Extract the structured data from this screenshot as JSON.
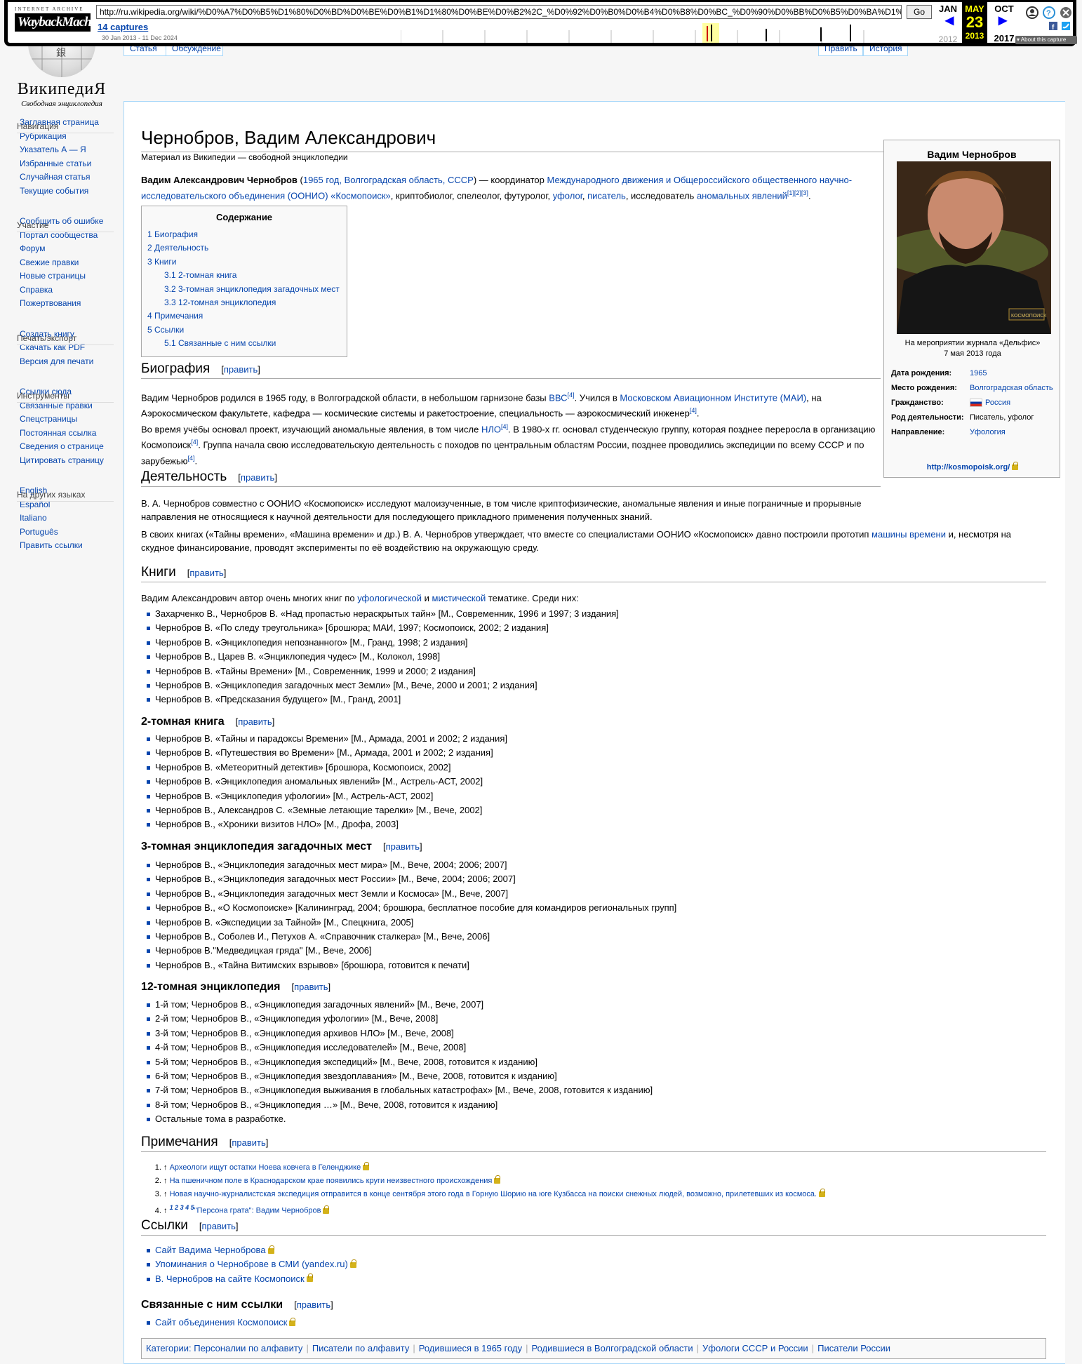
{
  "wayback": {
    "brand_top": "INTERNET ARCHIVE",
    "brand": "WaybackMachine",
    "url": "http://ru.wikipedia.org/wiki/%D0%A7%D0%B5%D1%80%D0%BD%D0%BE%D0%B1%D1%80%D0%BE%D0%B2%2C_%D0%92%D0%B0%D0%B4%D0%B8%D0%BC_%D0%90%D0%BB%D0%B5%D0%BA%D1%",
    "go": "Go",
    "captures": "14 captures",
    "range": "30 Jan 2013 - 11 Dec 2024",
    "prev_month": "JAN",
    "cur_month": "MAY",
    "next_month": "OCT",
    "day": "23",
    "prev_year": "2012",
    "cur_year": "2013",
    "next_year": "2017",
    "about": "About this capture"
  },
  "tabs": {
    "article": "Статья",
    "discussion": "Обсуждение",
    "edit": "Править",
    "history": "История"
  },
  "logo": {
    "name": "ВикипедиЯ",
    "sub": "Свободная энциклопедия"
  },
  "sidebar": [
    {
      "title": "Навигация",
      "items": [
        "Заглавная страница",
        "Рубрикация",
        "Указатель А — Я",
        "Избранные статьи",
        "Случайная статья",
        "Текущие события"
      ]
    },
    {
      "title": "Участие",
      "items": [
        "Сообщить об ошибке",
        "Портал сообщества",
        "Форум",
        "Свежие правки",
        "Новые страницы",
        "Справка",
        "Пожертвования"
      ]
    },
    {
      "title": "Печать/экспорт",
      "items": [
        "Создать книгу",
        "Скачать как PDF",
        "Версия для печати"
      ]
    },
    {
      "title": "Инструменты",
      "items": [
        "Ссылки сюда",
        "Связанные правки",
        "Спецстраницы",
        "Постоянная ссылка",
        "Сведения о странице",
        "Цитировать страницу"
      ]
    },
    {
      "title": "На других языках",
      "items": [
        "English",
        "Español",
        "Italiano",
        "Português",
        "Править ссылки"
      ]
    }
  ],
  "article": {
    "title": "Чернобров, Вадим Александрович",
    "sitesub": "Материал из Википедии — свободной энциклопедии",
    "edit": "править",
    "lead": {
      "bold": "Вадим Александрович Чернобров",
      "p1": " (",
      "l1": "1965 год",
      "p2": ", ",
      "l2": "Волгоградская область",
      "p3": ", ",
      "l3": "СССР",
      "p4": ") — координатор ",
      "l4": "Международного движения и Общероссийского общественного научно-исследовательского объединения (ООНИО) «Космопоиск»",
      "p5": ", криптобиолог, спелеолог, футуролог, ",
      "l5": "уфолог",
      "p6": ", ",
      "l6": "писатель",
      "p7": ", исследователь ",
      "l7": "аномальных явлений",
      "refs": "[1][2][3]",
      "p8": "."
    },
    "toc": {
      "title": "Содержание",
      "items": [
        {
          "t": "1 Биография",
          "l": 1
        },
        {
          "t": "2 Деятельность",
          "l": 1
        },
        {
          "t": "3 Книги",
          "l": 1
        },
        {
          "t": "3.1 2-томная книга",
          "l": 2
        },
        {
          "t": "3.2 3-томная энциклопедия загадочных мест",
          "l": 2
        },
        {
          "t": "3.3 12-томная энциклопедия",
          "l": 2
        },
        {
          "t": "4 Примечания",
          "l": 1
        },
        {
          "t": "5 Ссылки",
          "l": 1
        },
        {
          "t": "5.1 Связанные с ним ссылки",
          "l": 2
        }
      ]
    },
    "h_bio": "Биография",
    "bio1": {
      "a": "Вадим Чернобров родился в 1965 году, в Волгоградской области, в небольшом гарнизоне базы ",
      "l1": "ВВС",
      "r1": "[4]",
      "b": ". Учился в ",
      "l2": "Московском Авиационном Институте (МАИ)",
      "c": ", на Аэрокосмическом факультете, кафедра — космические системы и ракетостроение, специальность — аэрокосмический инженер",
      "r2": "[4]",
      "d": "."
    },
    "bio2": {
      "a": "Во время учёбы основал проект, изучающий аномальные явления, в том числе ",
      "l1": "НЛО",
      "r1": "[4]",
      "b": ". В 1980-х гг. основал студенческую группу, которая позднее переросла в организацию Космопоиск",
      "r2": "[4]",
      "c": ". Группа начала свою исследовательскую деятельность с походов по центральным областям России, позднее проводились экспедиции по всему СССР и по зарубежью",
      "r3": "[4]",
      "d": "."
    },
    "h_act": "Деятельность",
    "act1": "В. А. Чернобров совместно с ООНИО «Космопоиск» исследуют малоизученные, в том числе криптофизические, аномальные явления и иные пограничные и прорывные направления не относящиеся к научной деятельности для последующего прикладного применения полученных знаний.",
    "act2": {
      "a": "В своих книгах («Тайны времени», «Машина времени» и др.) В. А. Чернобров утверждает, что вместе со специалистами ООНИО «Космопоиск» давно построили прототип ",
      "l1": "машины времени",
      "b": " и, несмотря на скудное финансирование, проводят эксперименты по её воздействию на окружающую среду."
    },
    "h_books": "Книги",
    "books_intro": {
      "a": "Вадим Александрович автор очень многих книг по ",
      "l1": "уфологической",
      "b": " и ",
      "l2": "мистической",
      "c": " тематике. Среди них:"
    },
    "books": [
      "Захарченко В., Чернобров В. «Над пропастью нераскрытых тайн» [М., Современник, 1996 и 1997; 3 издания]",
      "Чернобров В. «По следу треугольника» [брошюра; МАИ, 1997; Космопоиск, 2002; 2 издания]",
      "Чернобров В. «Энциклопедия непознанного» [М., Гранд, 1998; 2 издания]",
      "Чернобров В., Царев В. «Энциклопедия чудес» [М., Колокол, 1998]",
      "Чернобров В. «Тайны Времени» [М., Современник, 1999 и 2000; 2 издания]",
      "Чернобров В. «Энциклопедия загадочных мест Земли» [М., Вече, 2000 и 2001; 2 издания]",
      "Чернобров В. «Предсказания будущего» [М., Гранд, 2001]"
    ],
    "h_2vol": "2-томная книга",
    "books2": [
      "Чернобров В. «Тайны и парадоксы Времени» [М., Армада, 2001 и 2002; 2 издания]",
      "Чернобров В. «Путешествия во Времени» [М., Армада, 2001 и 2002; 2 издания]",
      "Чернобров В. «Метеоритный детектив» [брошюра, Космопоиск, 2002]",
      "Чернобров В. «Энциклопедия аномальных явлений» [М., Астрель-АСТ, 2002]",
      "Чернобров В. «Энциклопедия уфологии» [М., Астрель-АСТ, 2002]",
      "Чернобров В., Александров С. «Земные летающие тарелки» [М., Вече, 2002]",
      "Чернобров В., «Хроники визитов НЛО» [М., Дрофа, 2003]"
    ],
    "h_3vol": "3-томная энциклопедия загадочных мест",
    "books3": [
      "Чернобров В., «Энциклопедия загадочных мест мира» [М., Вече, 2004; 2006; 2007]",
      "Чернобров В., «Энциклопедия загадочных мест России» [М., Вече, 2004; 2006; 2007]",
      "Чернобров В., «Энциклопедия загадочных мест Земли и Космоса» [М., Вече, 2007]",
      "Чернобров В., «О Космопоиске» [Калининград, 2004; брошюра, бесплатное пособие для командиров региональных групп]",
      "Чернобров В. «Экспедиции за Тайной» [М., Спецкнига, 2005]",
      "Чернобров В., Соболев И., Петухов А. «Справочник сталкера» [М., Вече, 2006]",
      "Чернобров В.\"Медведицкая гряда\" [М., Вече, 2006]",
      "Чернобров В., «Тайна Витимских взрывов» [брошюра, готовится к печати]"
    ],
    "h_12vol": "12-томная энциклопедия",
    "books12": [
      "1-й том; Чернобров В., «Энциклопедия загадочных явлений» [М., Вече, 2007]",
      "2-й том; Чернобров В., «Энциклопедия уфологии» [М., Вече, 2008]",
      "3-й том; Чернобров В., «Энциклопедия архивов НЛО» [М., Вече, 2008]",
      "4-й том; Чернобров В., «Энциклопедия исследователей» [М., Вече, 2008]",
      "5-й том; Чернобров В., «Энциклопедия экспедиций» [М., Вече, 2008, готовится к изданию]",
      "6-й том; Чернобров В., «Энциклопедия звездоплавания» [М., Вече, 2008, готовится к изданию]",
      "7-й том; Чернобров В., «Энциклопедия выживания в глобальных катастрофах» [М., Вече, 2008, готовится к изданию]",
      "8-й том; Чернобров В., «Энциклопедия …» [М., Вече, 2008, готовится к изданию]",
      "Остальные тома в разработке."
    ],
    "h_notes": "Примечания",
    "notes": [
      {
        "pre": "↑ ",
        "t": "Археологи ищут остатки Ноева ковчега в Геленджике"
      },
      {
        "pre": "↑ ",
        "t": "На пшеничном поле в Краснодарском крае появились круги неизвестного происхождения"
      },
      {
        "pre": "↑ ",
        "t": "Новая научно-журналистская экспедиция отправится в конце сентября этого года в Горную Шорию на юге Кузбасса на поиски снежных людей, возможно, прилетевших из космоса."
      },
      {
        "pre": "↑ ",
        "sup": "1 2 3 4 5",
        "t": "\"Персона грата\": Вадим Чернобров"
      }
    ],
    "h_links": "Ссылки",
    "links": [
      "Сайт Вадима Черноброва",
      "Упоминания о Черноброве в СМИ (yandex.ru)",
      "В. Чернобров на сайте Космопоиск"
    ],
    "h_related": "Связанные с ним ссылки",
    "related": [
      "Сайт объединения Космопоиск"
    ],
    "categories_label": "Категории:",
    "categories": [
      "Персоналии по алфавиту",
      "Писатели по алфавиту",
      "Родившиеся в 1965 году",
      "Родившиеся в Волгоградской области",
      "Уфологи СССР и России",
      "Писатели России"
    ]
  },
  "infobox": {
    "title": "Вадим Чернобров",
    "caption1": "На мероприятии журнала «Дельфис»",
    "caption2": "7 мая 2013 года",
    "rows": [
      {
        "k": "Дата рождения:",
        "v": "1965",
        "link": true
      },
      {
        "k": "Место рождения:",
        "v": "Волгоградская область",
        "link": true
      },
      {
        "k": "Гражданство:",
        "v": "Россия",
        "link": true,
        "flag": true
      },
      {
        "k": "Род деятельности:",
        "v": "Писатель, уфолог",
        "link": false
      },
      {
        "k": "Направление:",
        "v": "Уфология",
        "link": true
      }
    ],
    "url": "http://kosmopoisk.org/",
    "badge": "КОСМОПОИСК"
  }
}
